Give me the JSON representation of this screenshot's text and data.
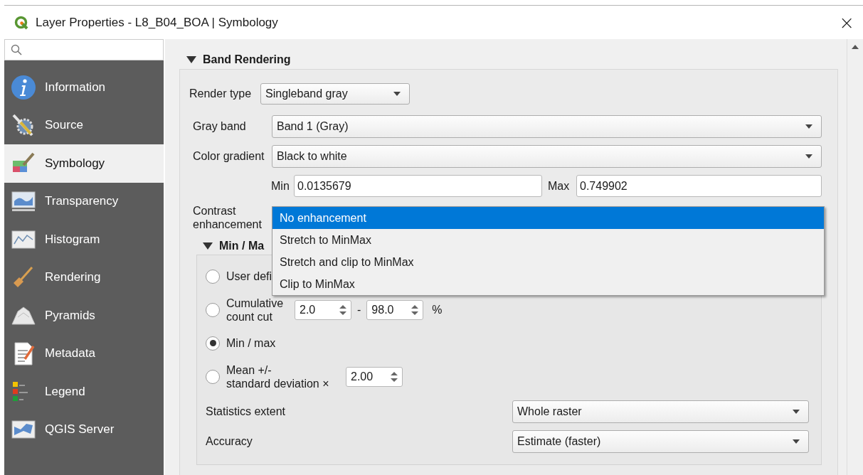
{
  "window": {
    "title": "Layer Properties - L8_B04_BOA | Symbology",
    "close": "×"
  },
  "sidebar": {
    "items": [
      {
        "label": "Information",
        "selected": false
      },
      {
        "label": "Source",
        "selected": false
      },
      {
        "label": "Symbology",
        "selected": true
      },
      {
        "label": "Transparency",
        "selected": false
      },
      {
        "label": "Histogram",
        "selected": false
      },
      {
        "label": "Rendering",
        "selected": false
      },
      {
        "label": "Pyramids",
        "selected": false
      },
      {
        "label": "Metadata",
        "selected": false
      },
      {
        "label": "Legend",
        "selected": false
      },
      {
        "label": "QGIS Server",
        "selected": false
      }
    ]
  },
  "band_rendering": {
    "title": "Band Rendering",
    "expanded": true,
    "render_type": {
      "label": "Render type",
      "value": "Singleband gray"
    },
    "gray_band": {
      "label": "Gray band",
      "value": "Band 1 (Gray)"
    },
    "color_gradient": {
      "label": "Color gradient",
      "value": "Black to white"
    },
    "min": {
      "label": "Min",
      "value": "0.0135679"
    },
    "max": {
      "label": "Max",
      "value": "0.749902"
    },
    "contrast_enhancement": {
      "label_lines": [
        "Contrast",
        "enhancement"
      ],
      "options": [
        {
          "label": "No enhancement",
          "selected": true
        },
        {
          "label": "Stretch to MinMax",
          "selected": false
        },
        {
          "label": "Stretch and clip to MinMax",
          "selected": false
        },
        {
          "label": "Clip to MinMax",
          "selected": false
        }
      ]
    }
  },
  "min_max_settings": {
    "title": "Min / Ma",
    "expanded": true,
    "options": [
      {
        "kind": "plain",
        "label_lines": [
          "User defi"
        ],
        "selected": false
      },
      {
        "kind": "range",
        "label_lines": [
          "Cumulative",
          "count cut"
        ],
        "selected": false,
        "from": "2.0",
        "separator": "-",
        "to": "98.0",
        "unit": "%"
      },
      {
        "kind": "plain",
        "label_lines": [
          "Min / max"
        ],
        "selected": true
      },
      {
        "kind": "factor",
        "label_lines": [
          "Mean +/-",
          "standard deviation ×"
        ],
        "selected": false,
        "value": "2.00"
      }
    ],
    "statistics_extent": {
      "label": "Statistics extent",
      "value": "Whole raster"
    },
    "accuracy": {
      "label": "Accuracy",
      "value": "Estimate (faster)"
    }
  }
}
